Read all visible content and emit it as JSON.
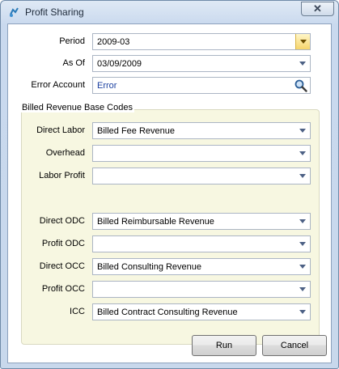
{
  "window": {
    "title": "Profit Sharing",
    "close_glyph": "✕"
  },
  "form": {
    "period": {
      "label": "Period",
      "value": "2009-03"
    },
    "as_of": {
      "label": "As Of",
      "value": "03/09/2009"
    },
    "error_account": {
      "label": "Error Account",
      "value": "Error",
      "value_color": "#1a3fa0"
    }
  },
  "group": {
    "title": "Billed Revenue Base Codes",
    "rows": [
      {
        "label": "Direct Labor",
        "value": "Billed Fee Revenue"
      },
      {
        "label": "Overhead",
        "value": ""
      },
      {
        "label": "Labor Profit",
        "value": ""
      },
      {
        "label": "Direct ODC",
        "value": "Billed Reimbursable Revenue"
      },
      {
        "label": "Profit ODC",
        "value": ""
      },
      {
        "label": "Direct OCC",
        "value": "Billed Consulting Revenue"
      },
      {
        "label": "Profit OCC",
        "value": ""
      },
      {
        "label": "ICC",
        "value": "Billed Contract Consulting Revenue"
      }
    ]
  },
  "buttons": {
    "run": "Run",
    "cancel": "Cancel"
  },
  "icons": {
    "app": "profit-sharing-app-icon",
    "close": "close-icon",
    "search": "search-icon",
    "dropdown": "chevron-down-icon"
  }
}
